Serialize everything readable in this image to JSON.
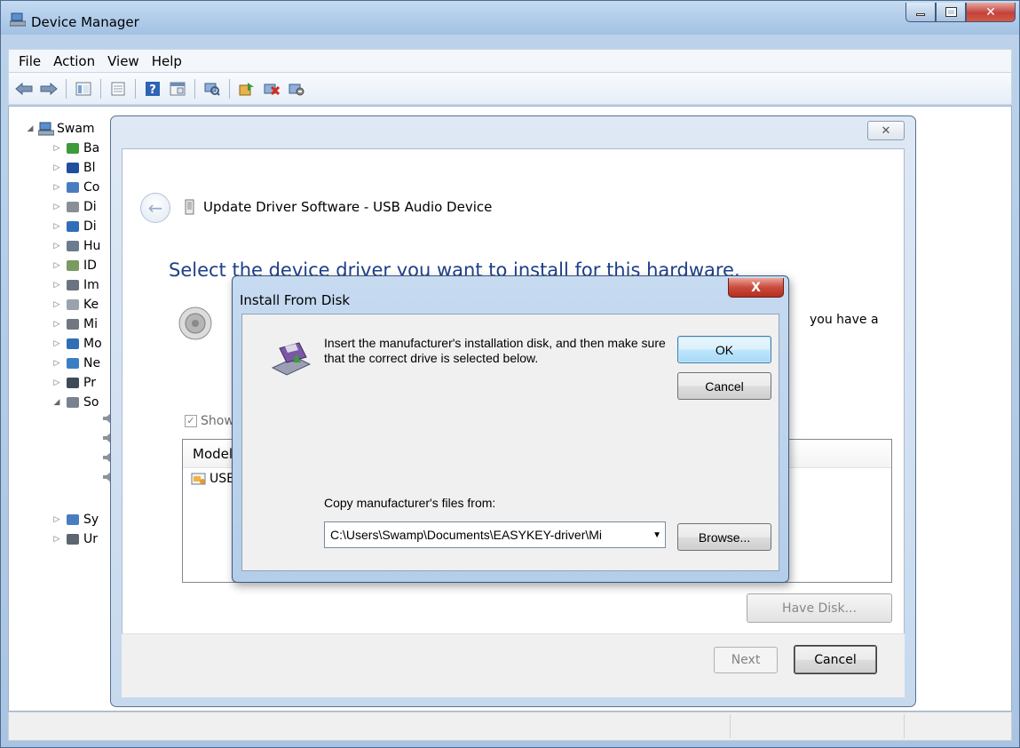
{
  "window": {
    "title": "Device Manager"
  },
  "menubar": {
    "items": [
      "File",
      "Action",
      "View",
      "Help"
    ]
  },
  "toolbar": {
    "icons": [
      "back-icon",
      "forward-icon",
      "tree-view-icon",
      "properties-icon",
      "help-icon",
      "show-hidden-icon",
      "scan-hardware-icon",
      "update-driver-icon",
      "uninstall-icon",
      "disable-icon"
    ]
  },
  "tree": {
    "root": "Swam",
    "rows": [
      {
        "label": "Ba",
        "icon": "battery-icon"
      },
      {
        "label": "Bl",
        "icon": "bluetooth-icon"
      },
      {
        "label": "Co",
        "icon": "computer-icon"
      },
      {
        "label": "Di",
        "icon": "disk-drive-icon"
      },
      {
        "label": "Di",
        "icon": "display-adapter-icon"
      },
      {
        "label": "Hu",
        "icon": "hid-icon"
      },
      {
        "label": "ID",
        "icon": "ide-controller-icon"
      },
      {
        "label": "Im",
        "icon": "imaging-device-icon"
      },
      {
        "label": "Ke",
        "icon": "keyboard-icon"
      },
      {
        "label": "Mi",
        "icon": "mouse-icon"
      },
      {
        "label": "Mo",
        "icon": "monitor-icon"
      },
      {
        "label": "Ne",
        "icon": "network-adapter-icon"
      },
      {
        "label": "Pr",
        "icon": "processor-icon"
      },
      {
        "label": "So",
        "icon": "sound-icon"
      },
      {
        "label": "Sy",
        "icon": "system-device-icon"
      },
      {
        "label": "Ur",
        "icon": "usb-controller-icon"
      }
    ]
  },
  "wizard": {
    "close_glyph": "✕",
    "header": "Update Driver Software - USB Audio Device",
    "heading": "Select the device driver you want to install for this hardware.",
    "description_tail": "you have a",
    "show_compatible": "Show",
    "model_header": "Model",
    "model_item": "USB",
    "have_disk": "Have Disk...",
    "next": "Next",
    "cancel": "Cancel"
  },
  "install_from_disk": {
    "title": "Install From Disk",
    "close_glyph": "X",
    "message": "Insert the manufacturer's installation disk, and then make sure that the correct drive is selected below.",
    "ok": "OK",
    "cancel": "Cancel",
    "copy_label": "Copy manufacturer's files from:",
    "path_value": "C:\\Users\\Swamp\\Documents\\EASYKEY-driver\\Mi",
    "browse": "Browse..."
  }
}
